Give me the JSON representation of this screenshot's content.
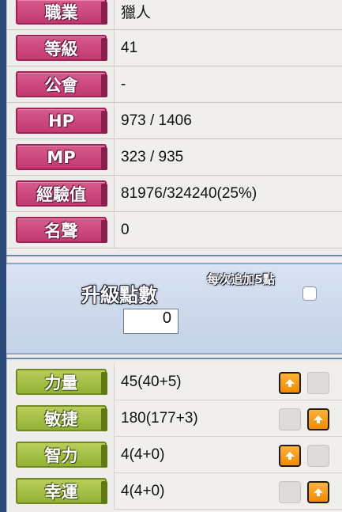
{
  "info_rows": [
    {
      "label": "職業",
      "value": "獵人"
    },
    {
      "label": "等級",
      "value": "41"
    },
    {
      "label": "公會",
      "value": "-"
    },
    {
      "label": "HP",
      "value": "973 / 1406"
    },
    {
      "label": "MP",
      "value": "323 / 935"
    },
    {
      "label": "經驗值",
      "value": "81976/324240(25%)"
    },
    {
      "label": "名聲",
      "value": "0"
    }
  ],
  "points": {
    "label": "升級點數",
    "value": "0",
    "per_add_label": "每次追加5點",
    "per_add_checked": false
  },
  "stats": [
    {
      "label": "力量",
      "value": "45(40+5)",
      "button_position": "left"
    },
    {
      "label": "敏捷",
      "value": "180(177+3)",
      "button_position": "right"
    },
    {
      "label": "智力",
      "value": "4(4+0)",
      "button_position": "left"
    },
    {
      "label": "幸運",
      "value": "4(4+0)",
      "button_position": "right"
    }
  ],
  "colors": {
    "info_label": "#c13a70",
    "stat_label": "#93b235",
    "add_button": "#f28a00"
  },
  "icons": {
    "add_button": "arrow-up-icon"
  }
}
